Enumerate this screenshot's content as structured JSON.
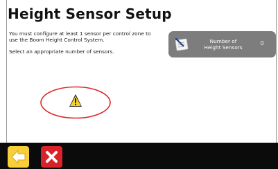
{
  "page": {
    "title": "Height Sensor Setup",
    "instructions": [
      "You must configure at least 1 sensor per control zone to use the Boom Height Control System.",
      "Select an appropriate number of sensors."
    ]
  },
  "sensor_button": {
    "label_line1": "Number of",
    "label_line2": "Height Sensors",
    "value": "0",
    "icon": "sensor-config-icon"
  },
  "warning": {
    "icon": "warning-triangle-icon",
    "highlight_color": "#e0262a"
  },
  "bottom_bar": {
    "back_icon": "back-arrow-icon",
    "cancel_icon": "cancel-x-icon",
    "back_color": "#f6cf3a",
    "cancel_color": "#d9232a"
  }
}
